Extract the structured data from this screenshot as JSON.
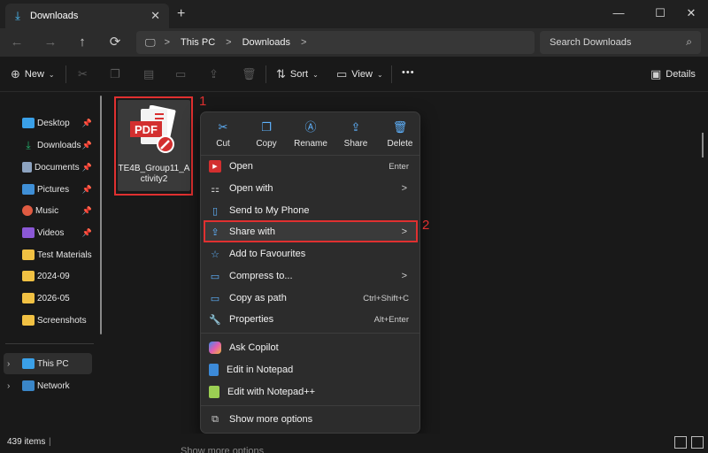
{
  "window": {
    "tab_title": "Downloads",
    "new_tab": "+",
    "minimize": "—",
    "maximize": "☐",
    "close": "✕"
  },
  "nav": {
    "back": "←",
    "forward": "→",
    "up": "↑",
    "refresh": "⟳"
  },
  "address": {
    "segments": [
      "This PC",
      "Downloads"
    ],
    "separator": ">"
  },
  "search": {
    "placeholder": "Search Downloads"
  },
  "toolbar": {
    "new_label": "New",
    "sort_label": "Sort",
    "view_label": "View",
    "more": "•••",
    "details_label": "Details"
  },
  "sidebar": {
    "items": [
      {
        "label": "Desktop",
        "icon": "desktop-icon",
        "color": "#3aa0e8",
        "pinned": true
      },
      {
        "label": "Downloads",
        "icon": "downloads-icon",
        "color": "#23b26d",
        "pinned": true
      },
      {
        "label": "Documents",
        "icon": "documents-icon",
        "color": "#8da3c0",
        "pinned": true
      },
      {
        "label": "Pictures",
        "icon": "pictures-icon",
        "color": "#3f8fd6",
        "pinned": true
      },
      {
        "label": "Music",
        "icon": "music-icon",
        "color": "#e05b42",
        "pinned": true
      },
      {
        "label": "Videos",
        "icon": "videos-icon",
        "color": "#8b58d6",
        "pinned": true
      },
      {
        "label": "Test Materials",
        "icon": "folder-icon",
        "color": "#f1c143",
        "pinned": false
      },
      {
        "label": "2024-09",
        "icon": "folder-icon",
        "color": "#f1c143",
        "pinned": false
      },
      {
        "label": "2026-05",
        "icon": "folder-icon",
        "color": "#f1c143",
        "pinned": false
      },
      {
        "label": "Screenshots",
        "icon": "folder-icon",
        "color": "#f1c143",
        "pinned": false
      }
    ],
    "this_pc": "This PC",
    "network": "Network"
  },
  "file": {
    "name_line1": "TE4B_Group11_A",
    "name_line2": "ctivity2",
    "thumb_text": "PDF"
  },
  "annotations": {
    "one": "1",
    "two": "2"
  },
  "context_menu": {
    "quick_actions": [
      {
        "label": "Cut",
        "icon": "cut-icon"
      },
      {
        "label": "Copy",
        "icon": "copy-icon"
      },
      {
        "label": "Rename",
        "icon": "rename-icon"
      },
      {
        "label": "Share",
        "icon": "share-icon"
      },
      {
        "label": "Delete",
        "icon": "delete-icon"
      }
    ],
    "items": [
      {
        "label": "Open",
        "shortcut": "Enter",
        "icon": "pdf-icon"
      },
      {
        "label": "Open with",
        "submenu": true,
        "icon": "open-with-icon"
      },
      {
        "label": "Send to My Phone",
        "icon": "phone-icon"
      },
      {
        "label": "Share with",
        "submenu": true,
        "icon": "share-with-icon"
      },
      {
        "label": "Add to Favourites",
        "icon": "star-icon"
      },
      {
        "label": "Compress to...",
        "submenu": true,
        "icon": "compress-icon"
      },
      {
        "label": "Copy as path",
        "shortcut": "Ctrl+Shift+C",
        "icon": "copy-path-icon"
      },
      {
        "label": "Properties",
        "shortcut": "Alt+Enter",
        "icon": "properties-icon"
      },
      {
        "label": "Ask Copilot",
        "icon": "copilot-icon"
      },
      {
        "label": "Edit in Notepad",
        "icon": "notepad-icon"
      },
      {
        "label": "Edit with Notepad++",
        "icon": "notepadpp-icon"
      },
      {
        "label": "Show more options",
        "icon": "more-options-icon"
      }
    ],
    "submenu_arrow": ">"
  },
  "status": {
    "item_count": "439 items",
    "divider": "|"
  },
  "ghost_text": "Show more options",
  "colors": {
    "accent": "#4cc2ff",
    "annotation": "#e03030"
  }
}
